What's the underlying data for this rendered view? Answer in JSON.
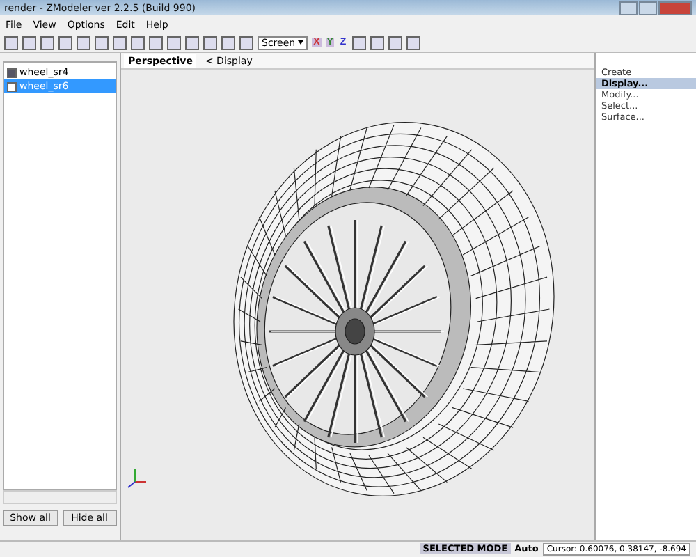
{
  "window": {
    "title": "render - ZModeler ver 2.2.5 (Build 990)"
  },
  "menu": [
    "File",
    "View",
    "Options",
    "Edit",
    "Help"
  ],
  "toolbar": {
    "view_dropdown": "Screen",
    "axes": [
      {
        "label": "X",
        "selected": true
      },
      {
        "label": "Y",
        "selected": true
      },
      {
        "label": "Z",
        "selected": false
      }
    ]
  },
  "objects": [
    {
      "name": "wheel_sr4",
      "checked": true,
      "selected": false
    },
    {
      "name": "wheel_sr6",
      "checked": false,
      "selected": true
    }
  ],
  "object_buttons": [
    "Show all",
    "Hide all"
  ],
  "viewport": {
    "tab": "Perspective",
    "display": "< Display"
  },
  "commands": [
    {
      "label": "Create",
      "selected": false
    },
    {
      "label": "Display...",
      "selected": true
    },
    {
      "label": "Modify...",
      "selected": false
    },
    {
      "label": "Select...",
      "selected": false
    },
    {
      "label": "Surface...",
      "selected": false
    }
  ],
  "status_bar": {
    "mode": "SELECTED MODE",
    "auto": "Auto",
    "cursor": "Cursor: 0.60076, 0.38147, -8.694"
  }
}
